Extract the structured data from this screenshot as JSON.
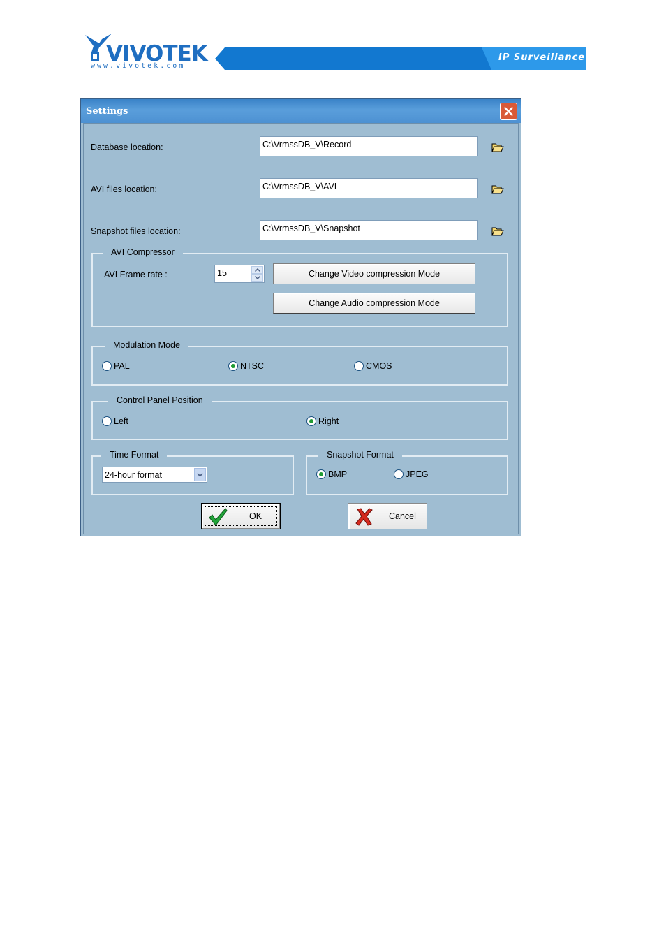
{
  "header": {
    "brand": "VIVOTEK",
    "url": "www.vivotek.com",
    "tagline": "IP Surveillance"
  },
  "dialog": {
    "title": "Settings",
    "database": {
      "label": "Database location:",
      "value": "C:\\VrmssDB_V\\Record"
    },
    "avi_files": {
      "label": "AVI files location:",
      "value": "C:\\VrmssDB_V\\AVI"
    },
    "snapshot_files": {
      "label": "Snapshot files location:",
      "value": "C:\\VrmssDB_V\\Snapshot"
    },
    "avi_compressor": {
      "legend": "AVI Compressor",
      "frame_rate_label": "AVI Frame rate :",
      "frame_rate_value": "15",
      "video_button": "Change Video compression Mode",
      "audio_button": "Change Audio compression Mode"
    },
    "modulation": {
      "legend": "Modulation Mode",
      "options": [
        "PAL",
        "NTSC",
        "CMOS"
      ],
      "selected": "NTSC"
    },
    "control_panel": {
      "legend": "Control Panel Position",
      "options": [
        "Left",
        "Right"
      ],
      "selected": "Right"
    },
    "time_format": {
      "legend": "Time Format",
      "value": "24-hour format"
    },
    "snapshot_format": {
      "legend": "Snapshot Format",
      "options": [
        "BMP",
        "JPEG"
      ],
      "selected": "BMP"
    },
    "ok_label": "OK",
    "cancel_label": "Cancel"
  },
  "colors": {
    "dialog_bg": "#9fbdd2",
    "titlebar": "#4d91d2",
    "brand_blue": "#1278d0",
    "close_red": "#d95a37",
    "radio_dot": "#1f9b33"
  }
}
